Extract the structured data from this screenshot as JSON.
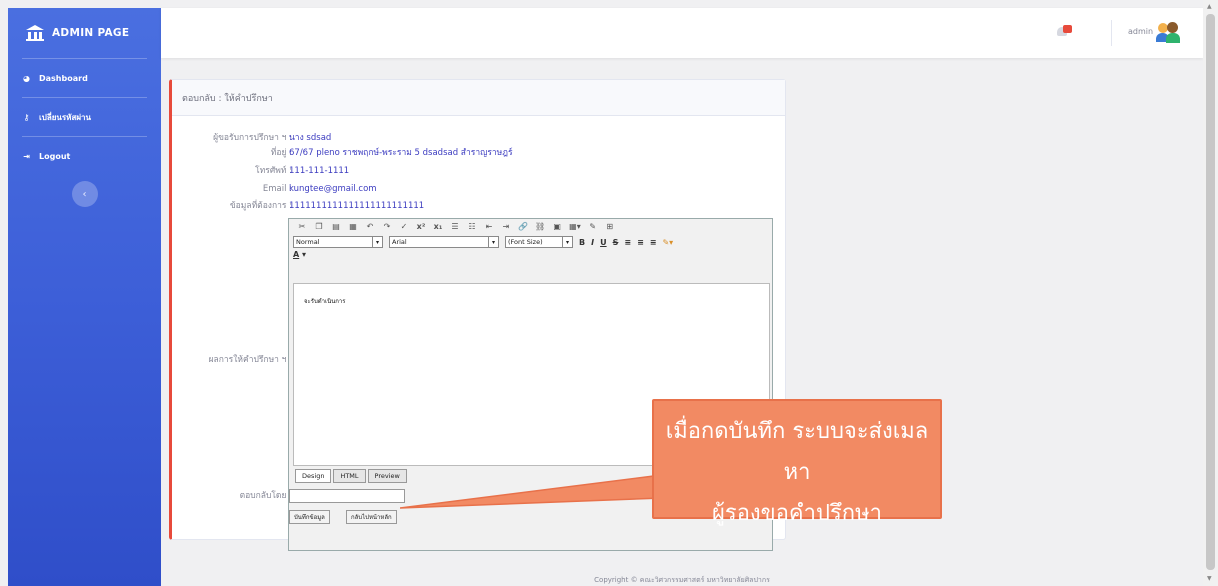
{
  "sidebar": {
    "brand": "ADMIN PAGE",
    "items": [
      {
        "icon": "dashboard-icon",
        "label": "Dashboard"
      },
      {
        "icon": "key-icon",
        "label": "เปลี่ยนรหัสผ่าน"
      },
      {
        "icon": "logout-icon",
        "label": "Logout"
      }
    ],
    "toggle_icon": "chevron-left-icon"
  },
  "topbar": {
    "user_name": "admin"
  },
  "card": {
    "header": "ตอบกลับ : ให้คำปรึกษา",
    "fields": [
      {
        "label": "ผู้ขอรับการปรึกษา ฯ :",
        "value": "นาง  sdsad"
      },
      {
        "label": "ที่อยู่ :",
        "value": "67/67 pleno ราชพฤกษ์-พระราม 5  dsadsad  สำราญราษฎร์"
      },
      {
        "label": "โทรศัพท์ :",
        "value": "111-111-1111"
      },
      {
        "label": "Email :",
        "value": "kungtee@gmail.com"
      },
      {
        "label": "ข้อมูลที่ต้องการ :",
        "value": "1111111111111111111111111"
      }
    ],
    "result_label": "ผลการให้คำปรึกษา ฯ :",
    "reply_by_label": "ตอบกลับโดย :",
    "save_button": "บันทึกข้อมูล",
    "back_button": "กลับไปหน้าหลัก"
  },
  "editor": {
    "style_select": "Normal",
    "font_select": "Arial",
    "size_select": "(Font Size)",
    "content": "จะรับดำเนินการ",
    "tabs": [
      "Design",
      "HTML",
      "Preview"
    ]
  },
  "callout": {
    "line1": "เมื่อกดบันทึก ระบบจะส่งเมลหา",
    "line2": "ผู้รองขอคำปรึกษา"
  },
  "footer": "Copyright © คณะวิศวกรรมศาสตร์ มหาวิทยาลัยศิลปากร",
  "colors": {
    "sidebar": "#4266da",
    "accent_border": "#e74a3b",
    "callout": "#f28a63",
    "value_text": "#3c3cc0"
  }
}
